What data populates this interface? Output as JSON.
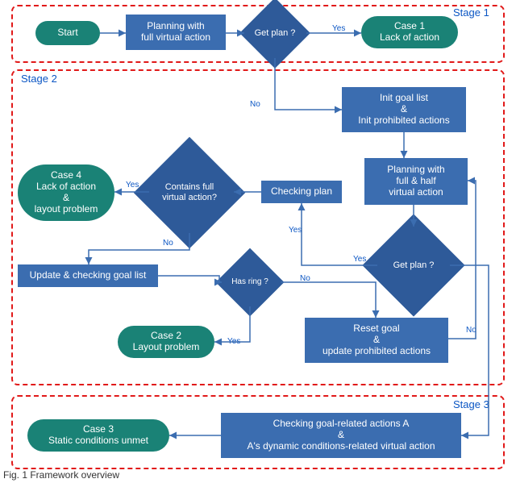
{
  "figure": {
    "caption": "Fig. 1  Framework overview"
  },
  "stages": {
    "s1": "Stage 1",
    "s2": "Stage 2",
    "s3": "Stage 3"
  },
  "nodes": {
    "start": "Start",
    "planFull": "Planning with\nfull virtual action",
    "getPlan1": "Get plan ?",
    "case1": "Case 1\nLack of action",
    "initGoal": "Init goal list\n&\nInit prohibited actions",
    "case4": "Case 4\nLack of action\n&\nlayout problem",
    "containsFull": "Contains full\nvirtual action?",
    "checking": "Checking plan",
    "planFullHalf": "Planning with\nfull & half\nvirtual action",
    "updateGoal": "Update & checking goal list",
    "hasRing": "Has ring ?",
    "getPlan2": "Get plan ?",
    "case2": "Case 2\nLayout problem",
    "resetGoal": "Reset goal\n&\nupdate prohibited actions",
    "case3": "Case 3\nStatic conditions unmet",
    "checkGoalRel": "Checking goal-related actions A\n&\nA's dynamic conditions-related virtual action"
  },
  "edges": {
    "yes": "Yes",
    "no": "No"
  }
}
